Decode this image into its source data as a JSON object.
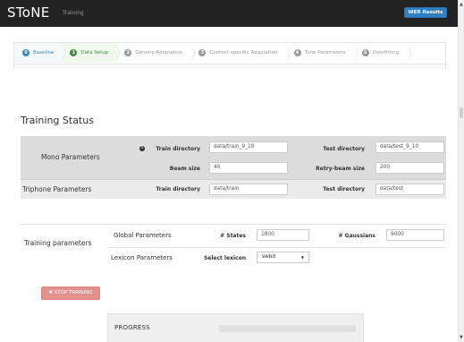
{
  "navbar": {
    "brand": "SToNE",
    "link": "Training",
    "wer_button": "WER Results"
  },
  "wizard": {
    "steps": [
      {
        "num": "0",
        "label": "Baseline",
        "state": "done"
      },
      {
        "num": "1",
        "label": "Data Setup",
        "state": "active"
      },
      {
        "num": "2",
        "label": "Generic Adaptation",
        "state": "pending"
      },
      {
        "num": "3",
        "label": "Context-specific Adaptation",
        "state": "pending"
      },
      {
        "num": "4",
        "label": "Tune Parameters",
        "state": "pending"
      },
      {
        "num": "5",
        "label": "Overfitting",
        "state": "pending"
      }
    ]
  },
  "status": {
    "title": "Training Status",
    "mono": {
      "label": "Mono Parameters",
      "info_icon": "i",
      "train_dir_label": "Train directory",
      "train_dir_value": "data/train_9_10",
      "test_dir_label": "Test directory",
      "test_dir_value": "data/test_9_10",
      "beam_label": "Beam size",
      "beam_value": "40",
      "retry_beam_label": "Retry-beam size",
      "retry_beam_value": "200"
    },
    "triphone": {
      "label": "Triphone Parameters",
      "train_dir_label": "Train directory",
      "train_dir_value": "data/train",
      "test_dir_label": "Test directory",
      "test_dir_value": "data/test"
    }
  },
  "training_params": {
    "title": "Training parameters",
    "global": {
      "label": "Global Parameters",
      "states_label": "# States",
      "states_value": "1800",
      "gaussians_label": "# Gaussians",
      "gaussians_value": "9000"
    },
    "lexicon": {
      "label": "Lexicon Parameters",
      "select_label": "Select lexicon",
      "select_value": "swbd"
    }
  },
  "stop_button": "✖ STOP TRAINING",
  "progress": {
    "title": "PROGRESS",
    "value": 0
  },
  "colors": {
    "navbar": "#222222",
    "wer_button": "#2f7fc1",
    "step_done": "#3a87ad",
    "step_active": "#468847",
    "stop_button": "#e4908d"
  },
  "icons": {
    "info": "info-icon",
    "stop": "close-icon",
    "select_caret": "caret-down-icon"
  }
}
